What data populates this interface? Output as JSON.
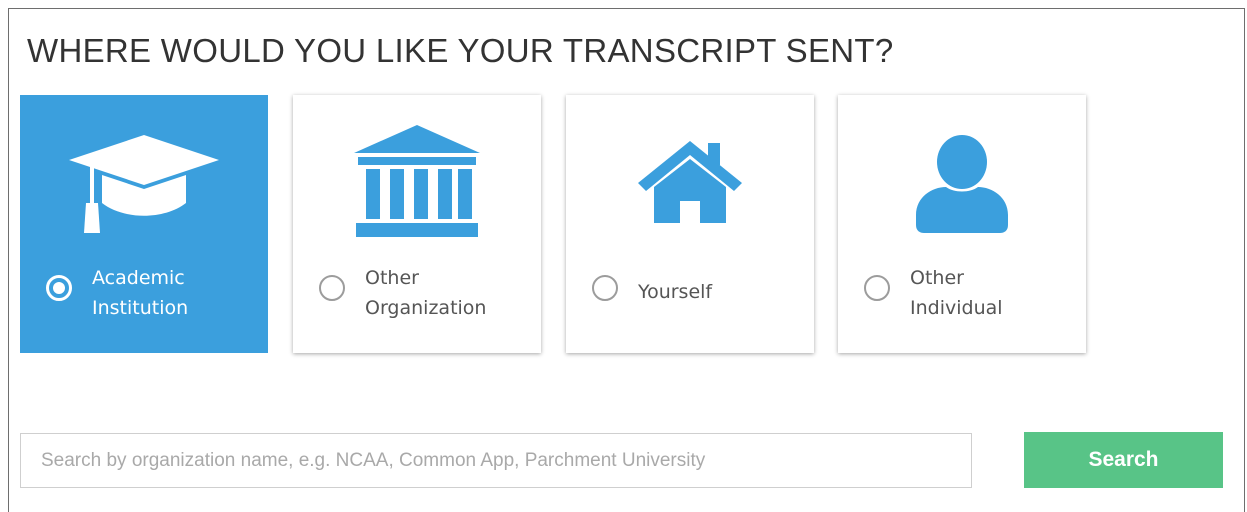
{
  "heading": "WHERE WOULD YOU LIKE YOUR TRANSCRIPT SENT?",
  "options": [
    {
      "line1": "Academic",
      "line2": "Institution",
      "icon": "graduation-cap-icon",
      "selected": true
    },
    {
      "line1": "Other",
      "line2": "Organization",
      "icon": "institution-building-icon",
      "selected": false
    },
    {
      "line1": "Yourself",
      "line2": "",
      "icon": "house-icon",
      "selected": false
    },
    {
      "line1": "Other",
      "line2": "Individual",
      "icon": "person-icon",
      "selected": false
    }
  ],
  "search": {
    "placeholder": "Search by organization name, e.g. NCAA, Common App, Parchment University",
    "value": "",
    "button_label": "Search"
  },
  "colors": {
    "accent_blue": "#3b9fdd",
    "search_green": "#58c487"
  }
}
